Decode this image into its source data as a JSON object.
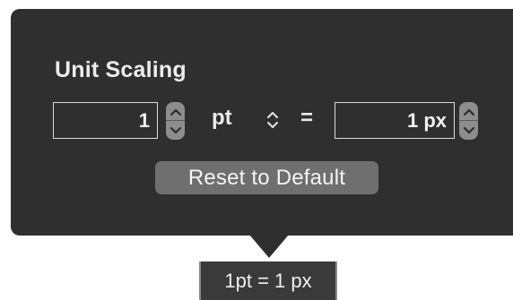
{
  "popover": {
    "title": "Unit Scaling",
    "left_field": {
      "value": "1"
    },
    "unit": "pt",
    "unit_popup_icon": "up-down-chevron-icon",
    "equals": "=",
    "right_field": {
      "value": "1 px"
    },
    "stepper_icon": "stepper-arrows-icon",
    "reset_button_label": "Reset to Default"
  },
  "tooltip": {
    "text": "1pt = 1 px"
  },
  "colors": {
    "popover_bg": "#2f2f2f",
    "text": "#ececec",
    "button_bg": "#6f6f6f",
    "stepper_bg": "#8d8d8d"
  }
}
